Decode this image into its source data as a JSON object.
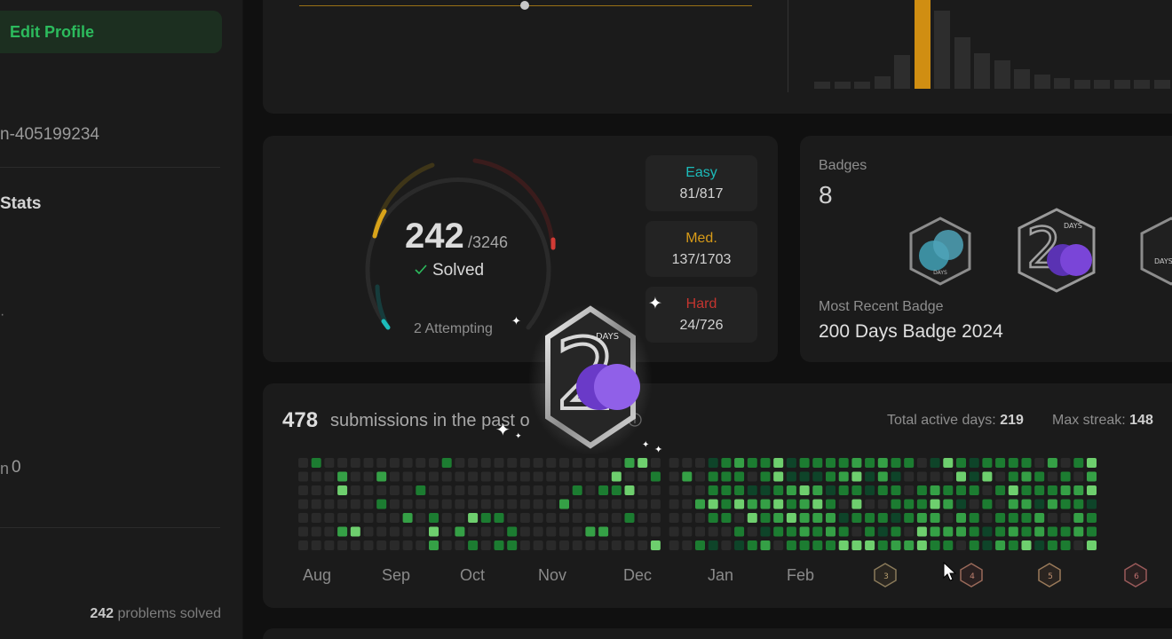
{
  "sidebar": {
    "edit_profile": "Edit Profile",
    "user_fragment": "n-405199234",
    "stats_heading": "Stats",
    "dot_fragment": "·",
    "rep_fragment": "n",
    "rep_value": "0",
    "footer_count": "242",
    "footer_text": "problems solved"
  },
  "solved": {
    "count": "242",
    "total": "/3246",
    "label": "Solved",
    "attempting": "2 Attempting",
    "difficulties": [
      {
        "name": "Easy",
        "value": "81/817",
        "color": "#1cbbba"
      },
      {
        "name": "Med.",
        "value": "137/1703",
        "color": "#d89b18"
      },
      {
        "name": "Hard",
        "value": "24/726",
        "color": "#c4352f"
      }
    ]
  },
  "badges": {
    "label": "Badges",
    "count": "8",
    "recent_label": "Most Recent Badge",
    "recent_name": "200 Days Badge 2024",
    "badge_texts": [
      "DAYS",
      "DAYS",
      "DAYS"
    ]
  },
  "floating_badge": {
    "text": "DAYS"
  },
  "submissions": {
    "count": "478",
    "text": "submissions in the past o",
    "active_label": "Total active days:",
    "active_value": "219",
    "streak_label": "Max streak:",
    "streak_value": "148",
    "months": [
      "Aug",
      "Sep",
      "Oct",
      "Nov",
      "Dec",
      "Jan",
      "Feb"
    ],
    "month_badges": [
      "3",
      "4",
      "5",
      "6"
    ]
  },
  "colors": {
    "background": "#101010",
    "card": "#1b1b1b",
    "accent_green": "#2cbb5d",
    "easy": "#1cbbba",
    "medium": "#d89b18",
    "hard": "#c4352f",
    "heat_empty": "#2a2a2a",
    "heat_low": "#0e4429",
    "heat_mid": "#1c7c31",
    "heat_high": "#35a046",
    "heat_top": "#6ecf6e"
  },
  "icons": [
    "check-icon",
    "info-icon",
    "sparkle-icon",
    "cursor-icon",
    "badge-icon"
  ]
}
